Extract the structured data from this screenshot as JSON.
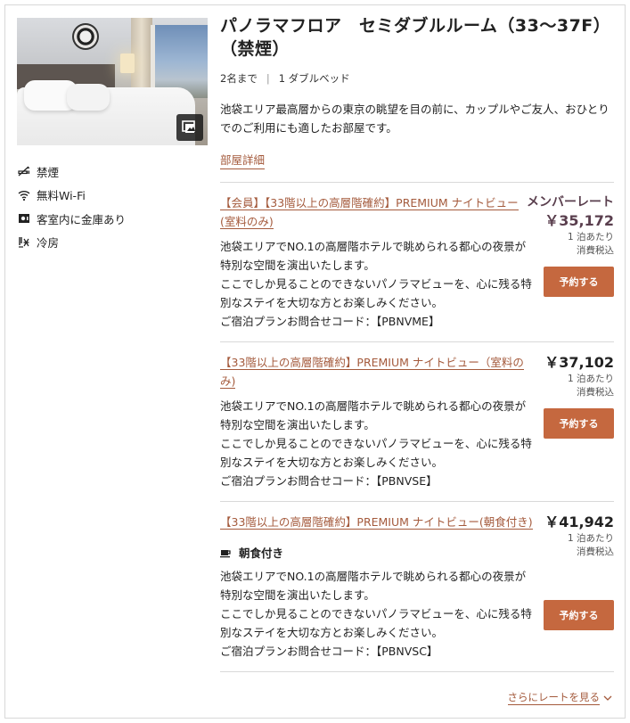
{
  "room": {
    "title": "パノラマフロア　セミダブルルーム（33～37F）（禁煙）",
    "capacity": "2名まで",
    "beds": "1 ダブルベッド",
    "description": "池袋エリア最高層からの東京の眺望を目の前に、カップルやご友人、おひとりでのご利用にも適したお部屋です。",
    "detail_link": "部屋詳細"
  },
  "amenities": [
    {
      "label": "禁煙",
      "icon": "no-smoking-icon"
    },
    {
      "label": "無料Wi-Fi",
      "icon": "wifi-icon"
    },
    {
      "label": "客室内に金庫あり",
      "icon": "safe-icon"
    },
    {
      "label": "冷房",
      "icon": "air-conditioning-icon"
    }
  ],
  "plans": [
    {
      "name": "【会員】【33階以上の高層階確約】PREMIUM ナイトビュー(室料のみ)",
      "description": "池袋エリアでNO.1の高層階ホテルで眺められる都心の夜景が特別な空間を演出いたします。\nここでしか見ることのできないパノラマビューを、心に残る特別なステイを大切な方とお楽しみください。\nご宿泊プランお問合せコード：【PBNVME】",
      "rate_label": "メンバーレート",
      "price": "￥35,172",
      "per_night": "1 泊あたり",
      "tax": "消費税込",
      "button": "予約する"
    },
    {
      "name": "【33階以上の高層階確約】PREMIUM ナイトビュー（室料のみ)",
      "description": "池袋エリアでNO.1の高層階ホテルで眺められる都心の夜景が特別な空間を演出いたします。\nここでしか見ることのできないパノラマビューを、心に残る特別なステイを大切な方とお楽しみください。\nご宿泊プランお問合せコード：【PBNVSE】",
      "price": "￥37,102",
      "per_night": "1 泊あたり",
      "tax": "消費税込",
      "button": "予約する"
    },
    {
      "name": "【33階以上の高層階確約】PREMIUM ナイトビュー(朝食付き)",
      "meal": "朝食付き",
      "description": "池袋エリアでNO.1の高層階ホテルで眺められる都心の夜景が特別な空間を演出いたします。\nここでしか見ることのできないパノラマビューを、心に残る特別なステイを大切な方とお楽しみください。\nご宿泊プランお問合せコード：【PBNVSC】",
      "price": "￥41,942",
      "per_night": "1 泊あたり",
      "tax": "消費税込",
      "button": "予約する"
    }
  ],
  "more_rates": "さらにレートを見る",
  "colors": {
    "accent": "#c5683f",
    "link": "#a45a3c",
    "member": "#5a3f4e"
  }
}
